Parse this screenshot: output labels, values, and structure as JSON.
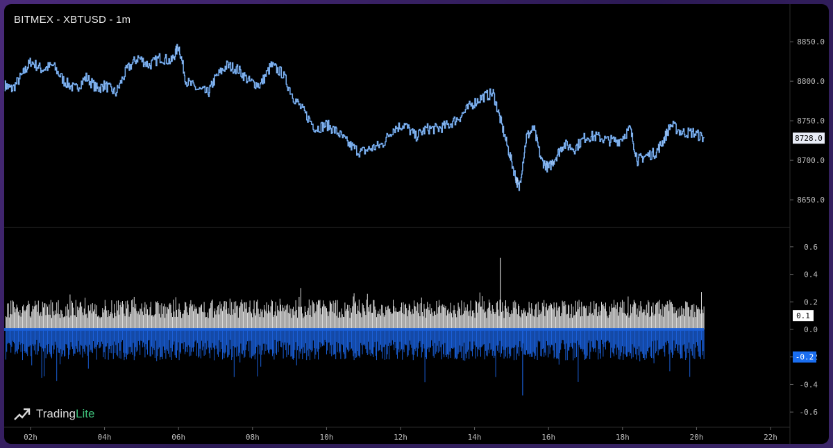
{
  "header": {
    "title": "BITMEX - XBTUSD - 1m"
  },
  "brand": {
    "name_main": "Trading",
    "name_accent": "Lite"
  },
  "colors": {
    "background": "#000000",
    "price_line": "#4d8fe0",
    "price_highlight": "#ffffff",
    "buy_volume": "#d9d9d9",
    "sell_volume": "#1a5fd8",
    "grid": "#2a2a2a"
  },
  "chart_data": [
    {
      "type": "line",
      "title": "BITMEX - XBTUSD - 1m",
      "x_ticks": [
        "02h",
        "04h",
        "06h",
        "08h",
        "10h",
        "12h",
        "14h",
        "16h",
        "18h",
        "20h",
        "22h"
      ],
      "y_ticks": [
        "8850.0",
        "8800.0",
        "8750.0",
        "8700.0",
        "8650.0"
      ],
      "ylim": [
        8615,
        8880
      ],
      "last_price_label": "8728.0",
      "series": [
        {
          "x_hours": [
            1.3,
            1.5,
            1.8,
            2.0,
            2.3,
            2.6,
            2.9,
            3.2,
            3.5,
            3.8,
            4.0,
            4.3,
            4.6,
            4.9,
            5.2,
            5.5,
            5.8,
            6.0,
            6.2,
            6.5,
            6.8,
            7.0,
            7.3,
            7.6,
            7.9,
            8.2,
            8.5,
            8.8,
            9.1,
            9.4,
            9.7,
            10.0,
            10.3,
            10.6,
            10.9,
            11.2,
            11.5,
            11.8,
            12.1,
            12.4,
            12.7,
            13.0,
            13.3,
            13.6,
            13.9,
            14.2,
            14.5,
            14.7,
            14.9,
            15.1,
            15.2,
            15.4,
            15.6,
            15.8,
            16.0,
            16.2,
            16.4,
            16.7,
            17.0,
            17.3,
            17.6,
            17.9,
            18.2,
            18.4,
            18.6,
            18.9,
            19.1,
            19.3,
            19.6,
            19.9,
            20.2
          ],
          "values": [
            8795,
            8790,
            8810,
            8825,
            8815,
            8820,
            8800,
            8790,
            8805,
            8790,
            8795,
            8785,
            8815,
            8830,
            8820,
            8830,
            8825,
            8845,
            8800,
            8790,
            8785,
            8805,
            8820,
            8815,
            8800,
            8795,
            8820,
            8810,
            8780,
            8760,
            8740,
            8745,
            8735,
            8720,
            8710,
            8715,
            8720,
            8740,
            8745,
            8730,
            8740,
            8740,
            8745,
            8755,
            8770,
            8780,
            8785,
            8750,
            8715,
            8680,
            8665,
            8730,
            8740,
            8700,
            8690,
            8705,
            8720,
            8715,
            8730,
            8730,
            8725,
            8725,
            8740,
            8700,
            8705,
            8710,
            8725,
            8745,
            8735,
            8735,
            8728
          ]
        }
      ]
    },
    {
      "type": "bar",
      "y_ticks": [
        "0.6",
        "0.4",
        "0.2",
        "0.0",
        "-0.2",
        "-0.4",
        "-0.6"
      ],
      "ylim": [
        -0.7,
        0.7
      ],
      "current_buy_label": "0.1",
      "current_sell_label": "-0.2",
      "series": [
        {
          "name": "",
          "typical_value": 0.15,
          "max_value": 0.52,
          "values_hint": "high-frequency buy volume per minute"
        },
        {
          "name": "",
          "typical_value": -0.15,
          "min_value": -0.48,
          "values_hint": "high-frequency sell volume per minute"
        }
      ]
    }
  ]
}
